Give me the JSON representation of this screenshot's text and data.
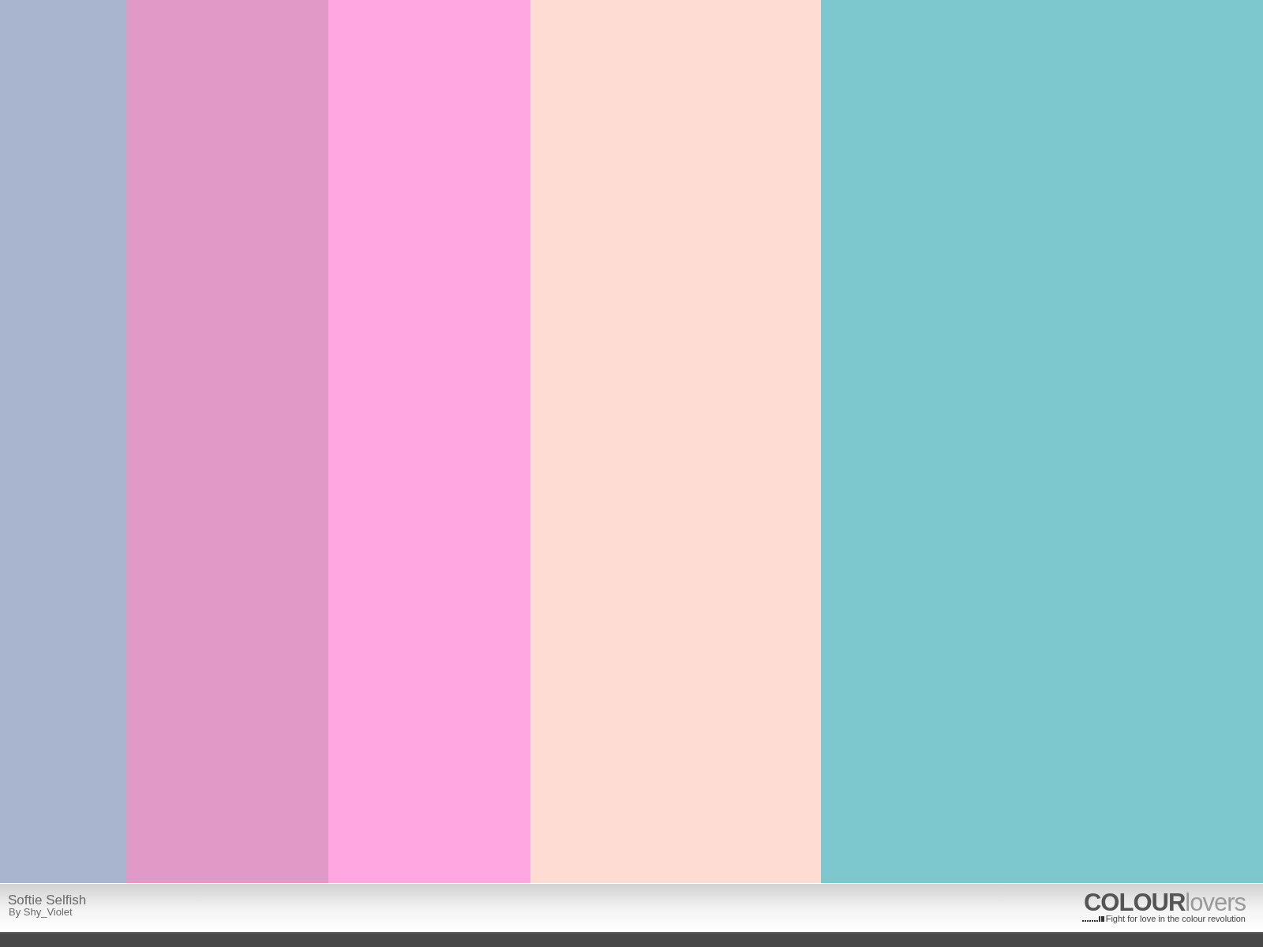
{
  "swatches": [
    {
      "color": "#a9b5ce"
    },
    {
      "color": "#e19ac8"
    },
    {
      "color": "#ffa7de"
    },
    {
      "color": "#ffdcd3"
    },
    {
      "color": "#7cc8ce"
    }
  ],
  "footer": {
    "title": "Softie Selfish",
    "author": "By Shy_Violet",
    "logo_bold": "COLOUR",
    "logo_light": "lovers",
    "tagline": "Fight for love in the colour revolution"
  }
}
